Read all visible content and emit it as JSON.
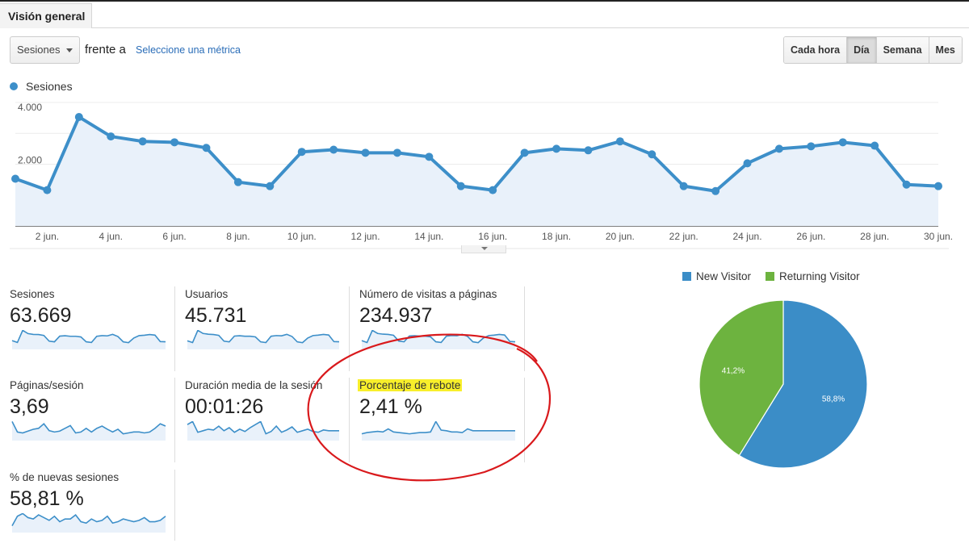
{
  "tabs": [
    {
      "label": "Visión general",
      "active": true
    }
  ],
  "toolbar": {
    "metric_select": {
      "value": "Sesiones"
    },
    "vs_label": "frente a",
    "select_metric_link": "Seleccione una métrica",
    "granularity": [
      {
        "label": "Cada hora",
        "active": false
      },
      {
        "label": "Día",
        "active": true
      },
      {
        "label": "Semana",
        "active": false
      },
      {
        "label": "Mes",
        "active": false
      }
    ]
  },
  "colors": {
    "series": "#3d8fc9",
    "area_fill": "#e9f1fa",
    "new_visitor": "#3b8dc7",
    "returning_visitor": "#6db33f",
    "highlight": "#f8ef2b",
    "annotation": "#d9191c"
  },
  "chart_data": [
    {
      "type": "area",
      "title": "",
      "legend": [
        "Sesiones"
      ],
      "legend_position": "top-left",
      "xlabel": "",
      "ylabel": "",
      "ylim": [
        0,
        4000
      ],
      "yticks": [
        {
          "value": 2000,
          "label": "2.000"
        },
        {
          "value": 4000,
          "label": "4.000"
        }
      ],
      "grid": true,
      "x": [
        "1 jun.",
        "2 jun.",
        "3 jun.",
        "4 jun.",
        "5 jun.",
        "6 jun.",
        "7 jun.",
        "8 jun.",
        "9 jun.",
        "10 jun.",
        "11 jun.",
        "12 jun.",
        "13 jun.",
        "14 jun.",
        "15 jun.",
        "16 jun.",
        "17 jun.",
        "18 jun.",
        "19 jun.",
        "20 jun.",
        "21 jun.",
        "22 jun.",
        "23 jun.",
        "24 jun.",
        "25 jun.",
        "26 jun.",
        "27 jun.",
        "28 jun.",
        "29 jun.",
        "30 jun."
      ],
      "xtick_labels": [
        "2 jun.",
        "4 jun.",
        "6 jun.",
        "8 jun.",
        "10 jun.",
        "12 jun.",
        "14 jun.",
        "16 jun.",
        "18 jun.",
        "20 jun.",
        "22 jun.",
        "24 jun.",
        "26 jun.",
        "28 jun.",
        "30 jun."
      ],
      "series": [
        {
          "name": "Sesiones",
          "values": [
            1530,
            1160,
            3530,
            2900,
            2740,
            2710,
            2530,
            1420,
            1290,
            2400,
            2470,
            2370,
            2370,
            2240,
            1290,
            1160,
            2370,
            2500,
            2450,
            2740,
            2320,
            1290,
            1130,
            2030,
            2500,
            2580,
            2710,
            2600,
            1340,
            1290
          ]
        }
      ]
    },
    {
      "type": "pie",
      "title": "",
      "legend": [
        "New Visitor",
        "Returning Visitor"
      ],
      "legend_position": "top",
      "slices": [
        {
          "name": "New Visitor",
          "value": 58.8,
          "label": "58,8%"
        },
        {
          "name": "Returning Visitor",
          "value": 41.2,
          "label": "41,2%"
        }
      ]
    }
  ],
  "scorecards": [
    {
      "label": "Sesiones",
      "value": "63.669",
      "highlighted": false,
      "spark": [
        1530,
        1160,
        3530,
        2900,
        2740,
        2710,
        2530,
        1420,
        1290,
        2400,
        2470,
        2370,
        2370,
        2240,
        1290,
        1160,
        2370,
        2500,
        2450,
        2740,
        2320,
        1290,
        1130,
        2030,
        2500,
        2580,
        2710,
        2600,
        1340,
        1290
      ]
    },
    {
      "label": "Usuarios",
      "value": "45.731",
      "highlighted": false,
      "spark": [
        1100,
        850,
        2600,
        2150,
        2050,
        2000,
        1880,
        1050,
        950,
        1780,
        1830,
        1760,
        1760,
        1660,
        950,
        850,
        1760,
        1850,
        1820,
        2030,
        1720,
        950,
        840,
        1500,
        1850,
        1910,
        2010,
        1930,
        990,
        960
      ]
    },
    {
      "label": "Número de visitas a páginas",
      "value": "234.937",
      "highlighted": false,
      "spark": [
        5600,
        4300,
        12900,
        10700,
        10200,
        10000,
        9400,
        5300,
        4800,
        8900,
        9100,
        8800,
        8800,
        8300,
        4800,
        4300,
        8800,
        9200,
        9100,
        10100,
        8600,
        4800,
        4200,
        7500,
        9200,
        9500,
        10000,
        9600,
        5000,
        4800
      ]
    },
    {
      "label": "Páginas/sesión",
      "value": "3,69",
      "highlighted": false,
      "spark": [
        3.95,
        3.72,
        3.7,
        3.74,
        3.78,
        3.8,
        3.9,
        3.75,
        3.72,
        3.74,
        3.8,
        3.86,
        3.7,
        3.72,
        3.8,
        3.72,
        3.8,
        3.85,
        3.78,
        3.72,
        3.78,
        3.68,
        3.7,
        3.72,
        3.72,
        3.7,
        3.72,
        3.8,
        3.9,
        3.85
      ]
    },
    {
      "label": "Duración media de la sesión",
      "value": "00:01:26",
      "highlighted": false,
      "spark": [
        92,
        96,
        82,
        84,
        86,
        85,
        90,
        84,
        88,
        82,
        86,
        83,
        88,
        92,
        96,
        80,
        83,
        90,
        82,
        85,
        89,
        82,
        84,
        86,
        83,
        82,
        85,
        84,
        84,
        84
      ]
    },
    {
      "label": "Porcentaje de rebote",
      "value": "2,41 %",
      "highlighted": true,
      "spark": [
        2.2,
        2.3,
        2.35,
        2.4,
        2.35,
        2.6,
        2.35,
        2.3,
        2.25,
        2.2,
        2.25,
        2.3,
        2.3,
        2.35,
        3.2,
        2.5,
        2.45,
        2.35,
        2.35,
        2.3,
        2.6,
        2.45,
        2.45,
        2.45,
        2.45,
        2.45,
        2.45,
        2.45,
        2.45,
        2.45
      ]
    },
    {
      "label": "% de nuevas sesiones",
      "value": "58,81 %",
      "highlighted": false,
      "spark": [
        58.5,
        59.2,
        59.4,
        59.1,
        59.0,
        59.3,
        59.1,
        58.9,
        59.2,
        58.8,
        59.0,
        59.0,
        59.3,
        58.8,
        58.7,
        59.0,
        58.8,
        58.9,
        59.2,
        58.7,
        58.8,
        59.0,
        58.9,
        58.8,
        58.9,
        59.1,
        58.8,
        58.8,
        58.9,
        59.2
      ]
    }
  ]
}
